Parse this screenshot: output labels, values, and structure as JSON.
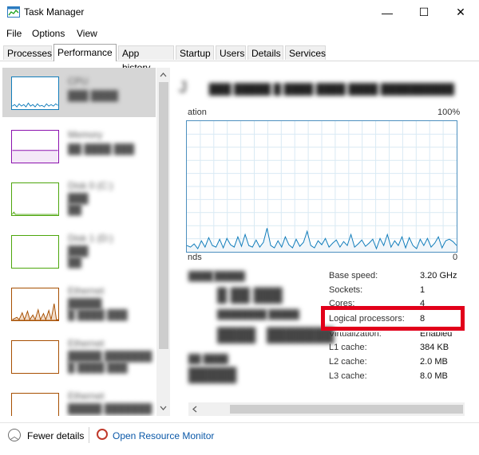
{
  "window": {
    "title": "Task Manager",
    "controls": [
      "—",
      "☐",
      "✕"
    ]
  },
  "menu": [
    "File",
    "Options",
    "View"
  ],
  "tabs": [
    {
      "label": "Processes"
    },
    {
      "label": "Performance",
      "active": true
    },
    {
      "label": "App history"
    },
    {
      "label": "Startup"
    },
    {
      "label": "Users"
    },
    {
      "label": "Details"
    },
    {
      "label": "Services"
    }
  ],
  "sidebar": {
    "tiles": [
      {
        "name": "CPU",
        "color": "#117dbb",
        "selected": true
      },
      {
        "name": "Memory",
        "color": "#8b12ae"
      },
      {
        "name": "Disk 0 (C:)",
        "color": "#4da60c"
      },
      {
        "name": "Disk 1 (D:)",
        "color": "#4da60c"
      },
      {
        "name": "Ethernet",
        "color": "#a74f01"
      },
      {
        "name": "Ethernet",
        "color": "#a74f01"
      },
      {
        "name": "Ethernet",
        "color": "#a74f01"
      }
    ]
  },
  "graph": {
    "left_label": "ation",
    "top_right_label": "100%",
    "bottom_left_label": "nds",
    "bottom_right_label": "0",
    "line_color": "#117dbb",
    "fill_color": "#f1f6fa",
    "grid_color": "#d9eaf4"
  },
  "stats": [
    {
      "label": "Base speed:",
      "value": "3.20 GHz"
    },
    {
      "label": "Sockets:",
      "value": "1"
    },
    {
      "label": "Cores:",
      "value": "4"
    },
    {
      "label": "Logical processors:",
      "value": "8"
    },
    {
      "label": "Virtualization:",
      "value": "Enabled"
    },
    {
      "label": "L1 cache:",
      "value": "384 KB"
    },
    {
      "label": "L2 cache:",
      "value": "2.0 MB"
    },
    {
      "label": "L3 cache:",
      "value": "8.0 MB"
    }
  ],
  "highlight_color": "#e2001a",
  "bottom": {
    "fewer_details": "Fewer details",
    "open_resource_monitor": "Open Resource Monitor"
  }
}
